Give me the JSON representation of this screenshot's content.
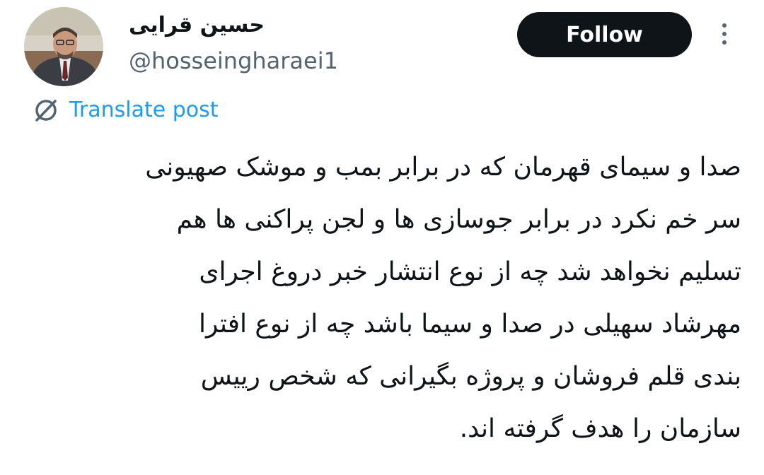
{
  "author": {
    "display_name": "حسین قرایی",
    "handle": "@hosseingharaei1"
  },
  "actions": {
    "follow_label": "Follow",
    "more_icon": "more-vertical-icon"
  },
  "translate": {
    "label": "Translate post",
    "icon": "translate-icon"
  },
  "post": {
    "lines": [
      "صدا و سیمای قهرمان که در برابر بمب و موشک صهیونی",
      "سر خم نکرد در برابر جوسازی ها و لجن پراکنی ها هم",
      "تسلیم نخواهد شد چه از نوع انتشار خبر دروغ اجرای",
      "مهرشاد سهیلی در صدا و سیما باشد چه از نوع افترا",
      "بندی قلم فروشان و پروژه بگیرانی که شخص رییس",
      "سازمان را هدف گرفته اند."
    ]
  },
  "colors": {
    "link_blue": "#1d9bf0",
    "text_primary": "#0f1419",
    "text_secondary": "#536471",
    "follow_bg": "#0f1419"
  }
}
